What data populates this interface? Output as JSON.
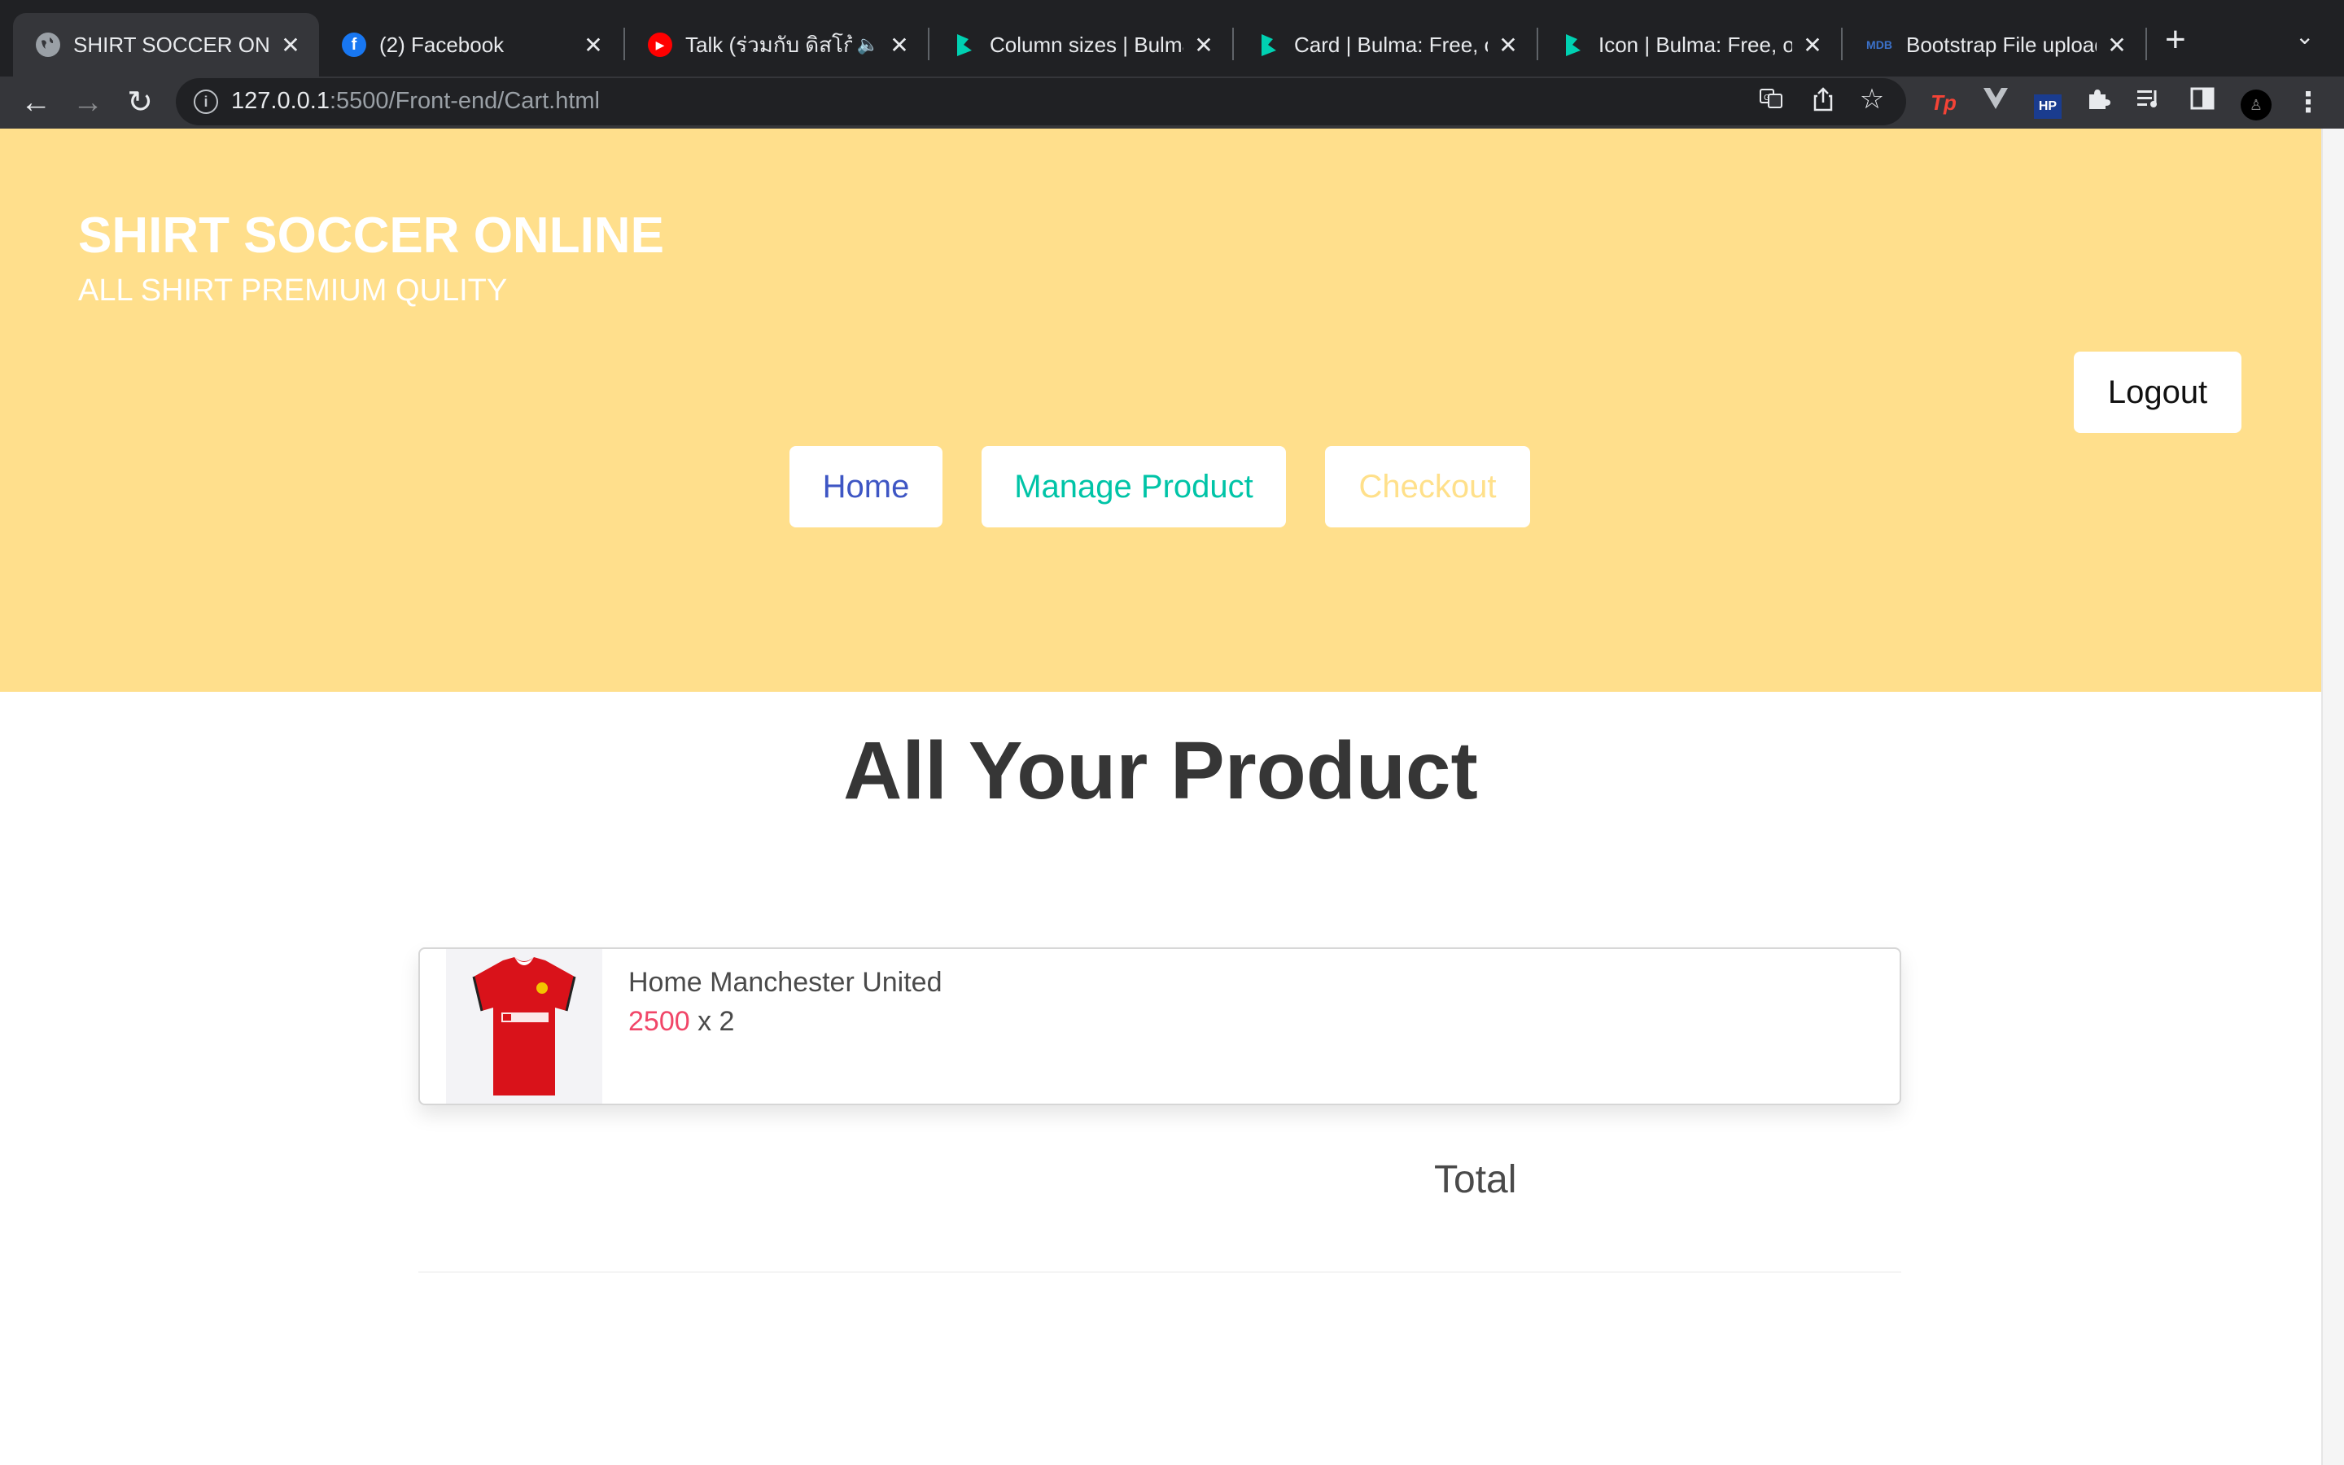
{
  "browser": {
    "tabs": [
      {
        "title": "SHIRT SOCCER ONLINE",
        "favicon": "globe-icon",
        "active": true
      },
      {
        "title": "(2) Facebook",
        "favicon": "facebook-icon"
      },
      {
        "title": "Talk (ร่วมกับ ดิสโก้",
        "favicon": "youtube-icon",
        "audio": true
      },
      {
        "title": "Column sizes | Bulma:",
        "favicon": "bulma-icon"
      },
      {
        "title": "Card | Bulma: Free, op",
        "favicon": "bulma-icon"
      },
      {
        "title": "Icon | Bulma: Free, op",
        "favicon": "bulma-icon"
      },
      {
        "title": "Bootstrap File upload",
        "favicon": "mdb-icon"
      }
    ],
    "url_host": "127.0.0.1",
    "url_path": ":5500/Front-end/Cart.html",
    "accent": "#202124"
  },
  "hero": {
    "title": "SHIRT SOCCER ONLINE",
    "subtitle": "ALL SHIRT PREMIUM QULITY",
    "background": "#ffdf8c"
  },
  "nav": {
    "logout": "Logout",
    "home": "Home",
    "manage": "Manage Product",
    "checkout": "Checkout"
  },
  "main": {
    "heading": "All Your Product",
    "cart_items": [
      {
        "name": "Home Manchester United",
        "price": "2500",
        "qty_text": "x 2"
      }
    ],
    "total_label": "Total"
  }
}
